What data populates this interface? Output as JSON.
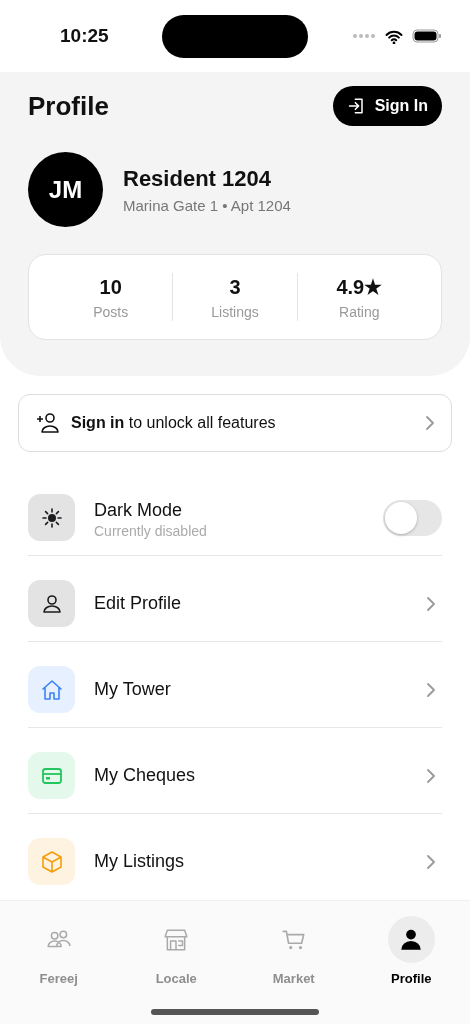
{
  "status_bar": {
    "time": "10:25"
  },
  "header": {
    "title": "Profile",
    "sign_in_button": "Sign In"
  },
  "profile": {
    "initials": "JM",
    "name": "Resident 1204",
    "subtitle": "Marina Gate 1 • Apt 1204"
  },
  "stats": [
    {
      "value": "10",
      "label": "Posts"
    },
    {
      "value": "3",
      "label": "Listings"
    },
    {
      "value": "4.9★",
      "label": "Rating"
    }
  ],
  "sign_in_banner": {
    "text": "**Sign in** to unlock all features"
  },
  "menu": [
    {
      "kind": "toggle",
      "label": "Dark Mode",
      "subtitle": "Currently disabled",
      "on": false,
      "color": "#1c1c1e"
    },
    {
      "kind": "link",
      "label": "Edit Profile",
      "color": "#1c1c1e"
    },
    {
      "kind": "link",
      "label": "My Tower",
      "color": "#3b82f6"
    },
    {
      "kind": "link",
      "label": "My Cheques",
      "color": "#22c55e"
    },
    {
      "kind": "link",
      "label": "My Listings",
      "color": "#f59e0b"
    }
  ],
  "tabs": [
    {
      "label": "Fereej",
      "selected": false
    },
    {
      "label": "Locale",
      "selected": false
    },
    {
      "label": "Market",
      "selected": false
    },
    {
      "label": "Profile",
      "selected": true
    }
  ]
}
